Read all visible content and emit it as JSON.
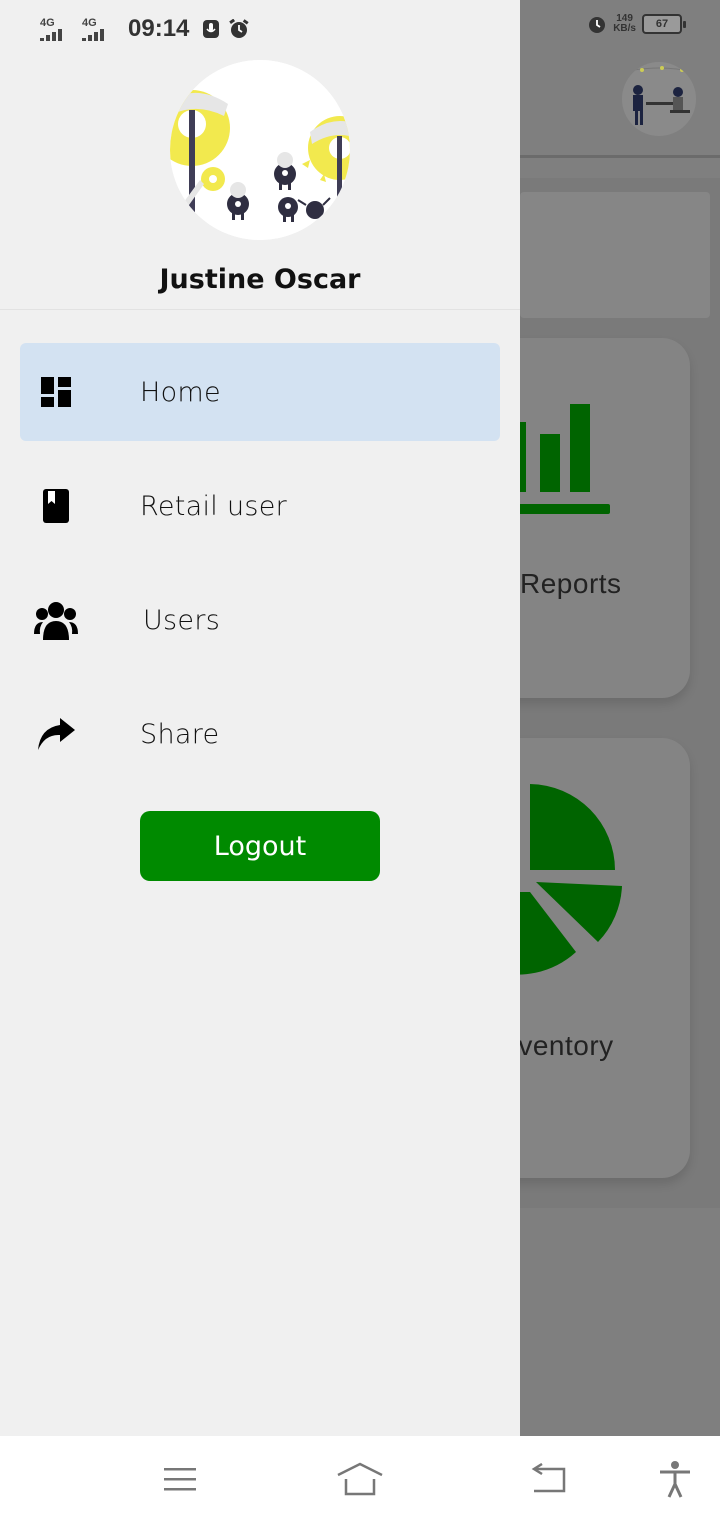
{
  "status_bar": {
    "signal_1_label": "4G",
    "signal_2_label": "4G",
    "time": "09:14",
    "net_speed_value": "149",
    "net_speed_unit": "KB/s",
    "battery_level": "67"
  },
  "drawer": {
    "user_name": "Justine Oscar",
    "menu": [
      {
        "label": "Home",
        "icon": "dashboard-icon",
        "active": true
      },
      {
        "label": "Retail user",
        "icon": "book-icon",
        "active": false
      },
      {
        "label": "Users",
        "icon": "users-icon",
        "active": false
      },
      {
        "label": "Share",
        "icon": "share-icon",
        "active": false
      }
    ],
    "logout_label": "Logout"
  },
  "background_app": {
    "card_1_label": "Reports",
    "card_2_label": "Inventory"
  },
  "navbar": {
    "icons": [
      "menu-icon",
      "home-icon",
      "back-icon",
      "accessibility-icon"
    ]
  },
  "colors": {
    "accent_green": "#008a00",
    "chart_green": "#006400",
    "active_item_bg": "#d3e2f2",
    "drawer_bg": "#f0f0f0"
  }
}
